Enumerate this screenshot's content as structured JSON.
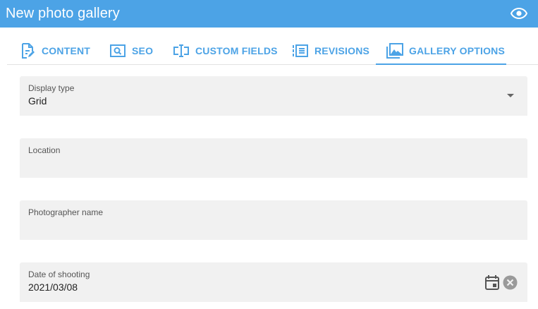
{
  "header": {
    "title": "New photo gallery",
    "preview_icon": "eye-icon"
  },
  "tabs": [
    {
      "label": "CONTENT",
      "icon": "document-edit-icon",
      "active": false
    },
    {
      "label": "SEO",
      "icon": "search-box-icon",
      "active": false
    },
    {
      "label": "CUSTOM FIELDS",
      "icon": "text-field-icon",
      "active": false
    },
    {
      "label": "REVISIONS",
      "icon": "revisions-list-icon",
      "active": false
    },
    {
      "label": "GALLERY OPTIONS",
      "icon": "photo-library-icon",
      "active": true
    }
  ],
  "form": {
    "display_type": {
      "label": "Display type",
      "value": "Grid"
    },
    "location": {
      "label": "Location",
      "value": ""
    },
    "photographer": {
      "label": "Photographer name",
      "value": ""
    },
    "date": {
      "label": "Date of shooting",
      "value": "2021/03/08"
    }
  },
  "colors": {
    "accent": "#4ca3e6",
    "field_bg": "#f1f1f1"
  }
}
